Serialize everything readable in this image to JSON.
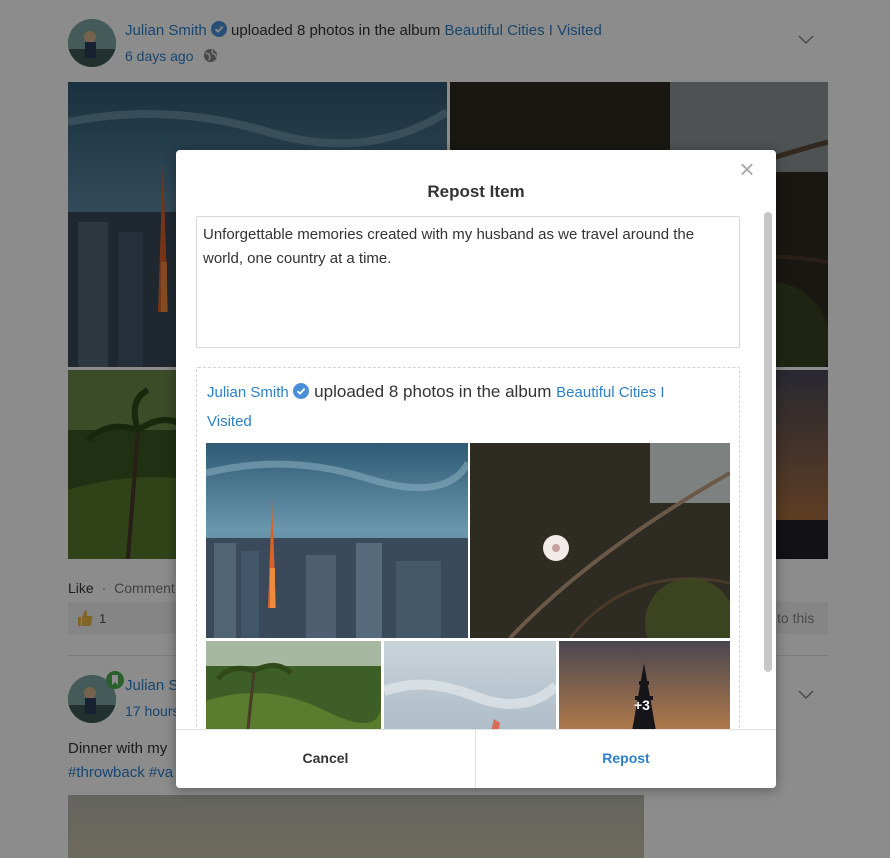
{
  "feed": {
    "post1": {
      "author": "Julian Smith",
      "action": "uploaded 8 photos in the album",
      "album": "Beautiful Cities I Visited",
      "time": "6 days ago",
      "like_label": "Like",
      "comment_label": "Comment",
      "like_count": "1",
      "comment_hint_tail": "to this"
    },
    "post2": {
      "author_partial": "Julian S",
      "time_partial": "17 hours",
      "body_partial": "Dinner with my",
      "hashtags_partial": "#throwback #va"
    }
  },
  "modal": {
    "title": "Repost Item",
    "close_icon": "×",
    "message": "Unforgettable memories created with my husband as we travel around the world, one country at a time.",
    "repost": {
      "author": "Julian Smith",
      "action": "uploaded 8 photos in the album",
      "album": "Beautiful Cities I Visited",
      "more_photos": "+3"
    },
    "cancel_label": "Cancel",
    "repost_label": "Repost"
  },
  "colors": {
    "link": "#2e80c9",
    "verified": "#4a90d9",
    "overlay": "rgba(0,0,0,0.45)"
  },
  "icons": {
    "verified": "verified-badge-icon",
    "globe": "globe-icon",
    "chevron": "chevron-down-icon",
    "thumb": "thumbs-up-icon",
    "close": "close-icon",
    "bookmark": "bookmark-badge-icon"
  }
}
